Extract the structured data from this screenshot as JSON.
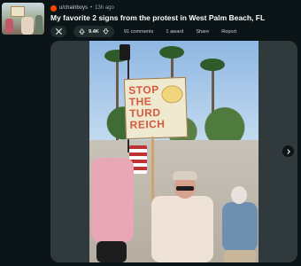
{
  "post": {
    "subreddit": "u/chainboys",
    "separator": "•",
    "time_ago": "13h ago",
    "title": "My favorite 2 signs from the protest in West Palm Beach, FL",
    "vote_count": "9.4K",
    "comments_label": "91 comments",
    "award_label": "1 award",
    "share_label": "Share",
    "report_label": "Report"
  },
  "media": {
    "sign_text_lines": [
      "STOP THE",
      "TURD",
      "REICH"
    ]
  },
  "colors": {
    "background": "#0b1416",
    "button_bg": "#202b2e",
    "subreddit_icon": "#ff4500",
    "media_bg": "#30393c"
  },
  "icons": {
    "close": "close-icon",
    "upvote": "upvote-arrow-icon",
    "downvote": "downvote-arrow-icon",
    "next": "chevron-right-icon"
  }
}
